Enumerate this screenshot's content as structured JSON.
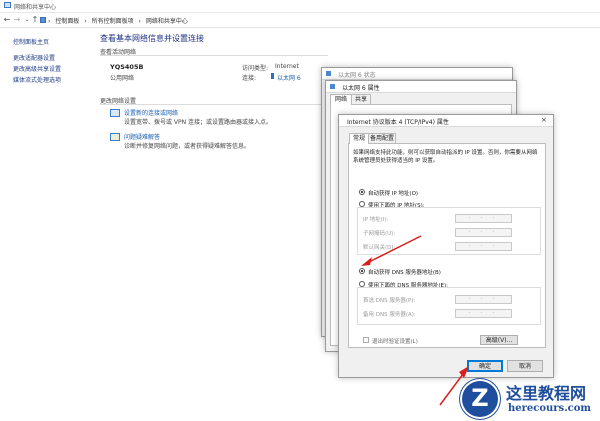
{
  "window": {
    "title": "网络和共享中心"
  },
  "addressbar": {
    "crumbs": [
      "控制面板",
      "所有控制面板项",
      "网络和共享中心"
    ]
  },
  "sidebar": {
    "items": [
      "控制面板主页",
      "更改适配器设置",
      "更改高级共享设置",
      "媒体流式处理选项"
    ]
  },
  "main": {
    "heading": "查看基本网络信息并设置连接",
    "active_networks_label": "查看活动网络",
    "network_name": "YQS405B",
    "network_type": "公用网络",
    "access_type_label": "访问类型:",
    "access_type_value": "Internet",
    "connections_label": "连接:",
    "connection_value": "以太网 6",
    "change_settings_label": "更改网络设置",
    "setup_link": "设置新的连接或网络",
    "setup_desc": "设置宽带、拨号或 VPN 连接；或设置路由器或接入点。",
    "troubleshoot_link": "问题疑难解答",
    "troubleshoot_desc": "诊断并修复网络问题，或者获得疑难解答信息。"
  },
  "status_dialog": {
    "title": "以太网 6 状态"
  },
  "props_dialog": {
    "title": "以太网 6 属性",
    "tabs": [
      "网络",
      "共享"
    ]
  },
  "ipv4_dialog": {
    "title": "Internet 协议版本 4 (TCP/IPv4) 属性",
    "tabs": [
      "常规",
      "备用配置"
    ],
    "description": "如果网络支持此功能，则可以获取自动指派的 IP 设置。否则，你需要从网络系统管理员处获得适当的 IP 设置。",
    "auto_ip": "自动获得 IP 地址(O)",
    "manual_ip": "使用下面的 IP 地址(S):",
    "ip_address": "IP 地址(I):",
    "subnet_mask": "子网掩码(U):",
    "gateway": "默认网关(D):",
    "auto_dns": "自动获得 DNS 服务器地址(B)",
    "manual_dns": "使用下面的 DNS 服务器地址(E):",
    "preferred_dns": "首选 DNS 服务器(P):",
    "alternate_dns": "备用 DNS 服务器(A):",
    "validate_on_exit": "退出时验证设置(L)",
    "advanced": "高级(V)...",
    "ok": "确定",
    "cancel": "取消",
    "ip_placeholder": "· · ·"
  },
  "watermark": {
    "cn": "这里教程网",
    "url": "herecours.com"
  },
  "colors": {
    "link": "#1a5fb4",
    "heading": "#1e3287",
    "accent": "#0078d7",
    "arrow": "#d81e1e"
  }
}
